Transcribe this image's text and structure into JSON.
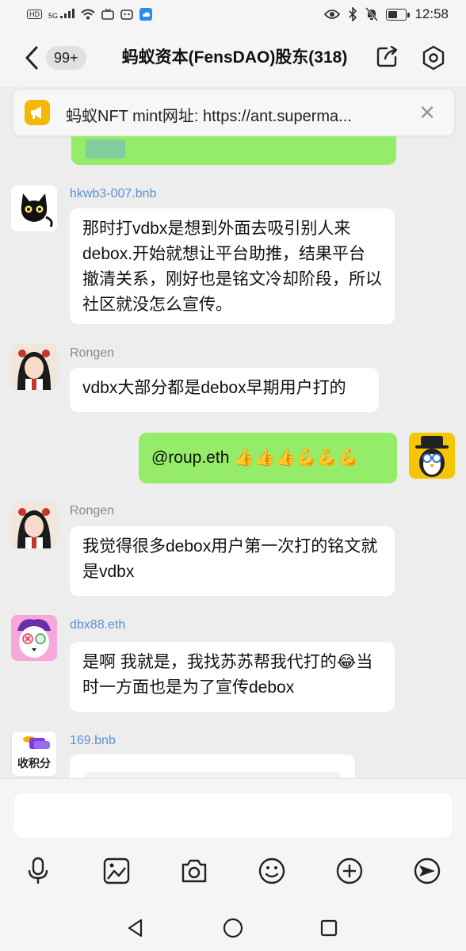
{
  "status_bar": {
    "network_badge": "HD",
    "signal_label": "5G",
    "time": "12:58",
    "battery_percent": 55
  },
  "header": {
    "unread_count": "99+",
    "title": "蚂蚁资本(FensDAO)股东(318)"
  },
  "notice": {
    "text": "蚂蚁NFT mint网址: https://ant.superma..."
  },
  "messages": [
    {
      "sender_name": "hkwb3-007",
      "sender_suffix": ".bnb",
      "text": "那时打vdbx是想到外面去吸引别人来debox.开始就想让平台助推，结果平台撤清关系，刚好也是铭文冷却阶段，所以社区就没怎么宣传。"
    },
    {
      "sender_name": "Rongen",
      "text": "vdbx大部分都是debox早期用户打的"
    },
    {
      "sender_name": "me",
      "text": "@roup.eth 👍👍👍💪💪💪"
    },
    {
      "sender_name": "Rongen",
      "text": "我觉得很多debox用户第一次打的铭文就是vdbx"
    },
    {
      "sender_name": "dbx88",
      "sender_suffix": ".eth",
      "text": "是啊 我就是，我找苏苏帮我代打的😂当时一方面也是为了宣传debox"
    },
    {
      "sender_name": "169",
      "sender_suffix": ".bnb",
      "avatar_label": "收积分"
    }
  ],
  "input": {
    "placeholder": ""
  },
  "toolbar": {
    "icons": [
      "microphone-icon",
      "image-icon",
      "camera-icon",
      "emoji-icon",
      "plus-icon",
      "send-icon"
    ]
  },
  "nav_bar": {
    "icons": [
      "back-triangle-icon",
      "home-circle-icon",
      "recents-square-icon"
    ]
  },
  "colors": {
    "my_bubble": "#95ec69",
    "other_bubble": "#ffffff",
    "background": "#ededed",
    "notice_icon": "#f5b800",
    "link_suffix": "#5b8fd6"
  }
}
